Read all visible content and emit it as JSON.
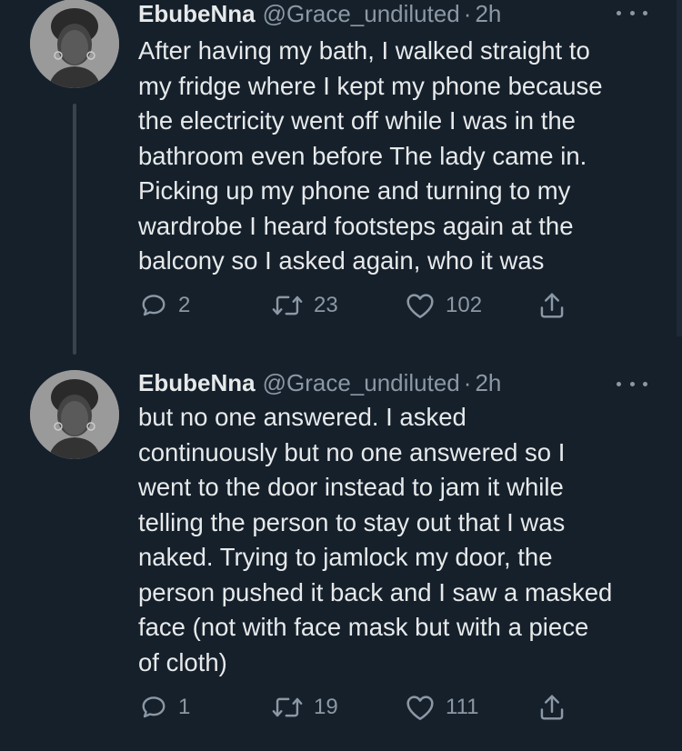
{
  "tweets": [
    {
      "name": "EbubeNna",
      "handle": "@Grace_undiluted",
      "separator": "·",
      "time": "2h",
      "text": "After having my bath, I walked straight to\nmy fridge where I kept my phone because\nthe electricity went off while I was in the\nbathroom even before The lady came in.\nPicking up my phone and turning to my\nwardrobe I heard footsteps again at the\nbalcony so I asked again, who it was",
      "replies": "2",
      "retweets": "23",
      "likes": "102"
    },
    {
      "name": "EbubeNna",
      "handle": "@Grace_undiluted",
      "separator": "·",
      "time": "2h",
      "text": "but no one answered. I asked\ncontinuously but no one answered so I\nwent to the door instead to jam it while\ntelling the person to stay out that I was\nnaked. Trying to jamlock my door, the\nperson pushed it back and I saw a masked\nface (not with face mask but with a piece\nof cloth)",
      "replies": "1",
      "retweets": "19",
      "likes": "111"
    }
  ],
  "colors": {
    "background": "#15202b",
    "primary_text": "#e7e9ea",
    "secondary_text": "#8b98a5",
    "thread_line": "#38444d"
  },
  "icons": {
    "reply": "reply-icon",
    "retweet": "retweet-icon",
    "like": "heart-icon",
    "share": "share-icon",
    "more": "more-icon"
  }
}
